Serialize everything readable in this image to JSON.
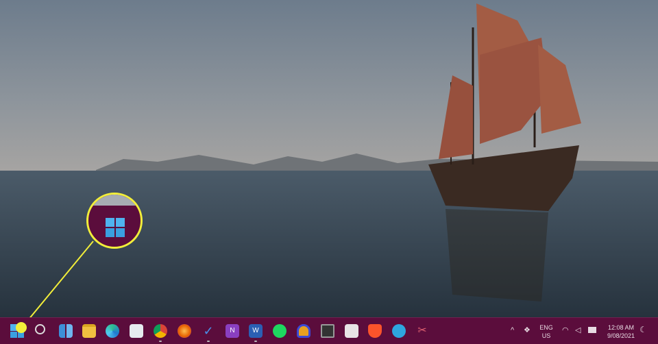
{
  "taskbar": {
    "color": "#5b0d3c",
    "apps": [
      {
        "name": "start",
        "icon": "windows-icon"
      },
      {
        "name": "search",
        "icon": "search-icon"
      },
      {
        "name": "task-view",
        "icon": "task-view-icon"
      },
      {
        "name": "file-explorer",
        "icon": "folder-icon"
      },
      {
        "name": "edge",
        "icon": "edge-icon"
      },
      {
        "name": "notepad",
        "icon": "quill-icon"
      },
      {
        "name": "chrome",
        "icon": "chrome-icon"
      },
      {
        "name": "firefox",
        "icon": "firefox-icon"
      },
      {
        "name": "todo",
        "icon": "checkmark-icon"
      },
      {
        "name": "onenote",
        "icon": "onenote-icon"
      },
      {
        "name": "word",
        "icon": "word-icon"
      },
      {
        "name": "spotify",
        "icon": "spotify-icon"
      },
      {
        "name": "headphones-app",
        "icon": "headphones-icon"
      },
      {
        "name": "camera-app",
        "icon": "camera-icon"
      },
      {
        "name": "store",
        "icon": "store-icon"
      },
      {
        "name": "brave",
        "icon": "brave-icon"
      },
      {
        "name": "telegram",
        "icon": "telegram-icon"
      },
      {
        "name": "snipping",
        "icon": "scissors-icon"
      }
    ],
    "tray": {
      "language": "ENG",
      "region": "US",
      "time": "12:08 AM",
      "date": "9/08/2021"
    }
  },
  "callout": {
    "color": "#f2ee3a"
  }
}
